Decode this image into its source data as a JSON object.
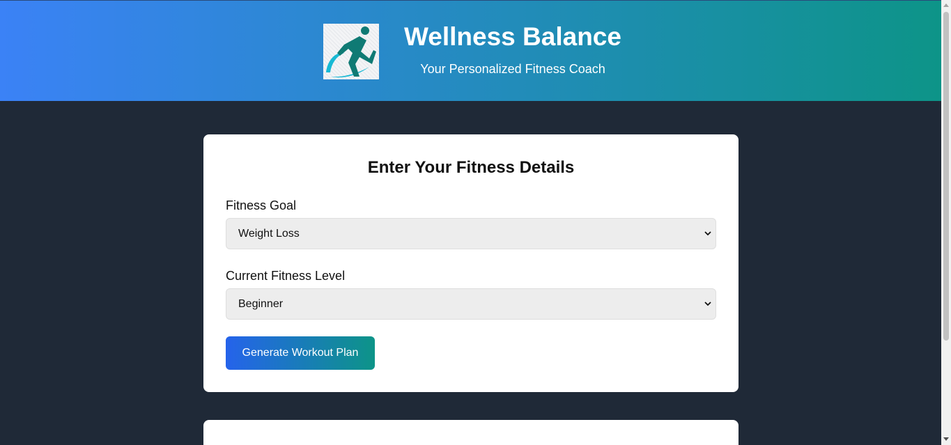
{
  "header": {
    "title": "Wellness Balance",
    "subtitle": "Your Personalized Fitness Coach",
    "logo_icon": "runner-logo-icon"
  },
  "form": {
    "heading": "Enter Your Fitness Details",
    "goal": {
      "label": "Fitness Goal",
      "selected": "Weight Loss"
    },
    "level": {
      "label": "Current Fitness Level",
      "selected": "Beginner"
    },
    "submit_label": "Generate Workout Plan"
  },
  "colors": {
    "header_gradient_start": "#3b82f6",
    "header_gradient_end": "#0d9488",
    "page_background": "#1f2937",
    "button_gradient_start": "#2563eb",
    "button_gradient_end": "#0d9488"
  }
}
